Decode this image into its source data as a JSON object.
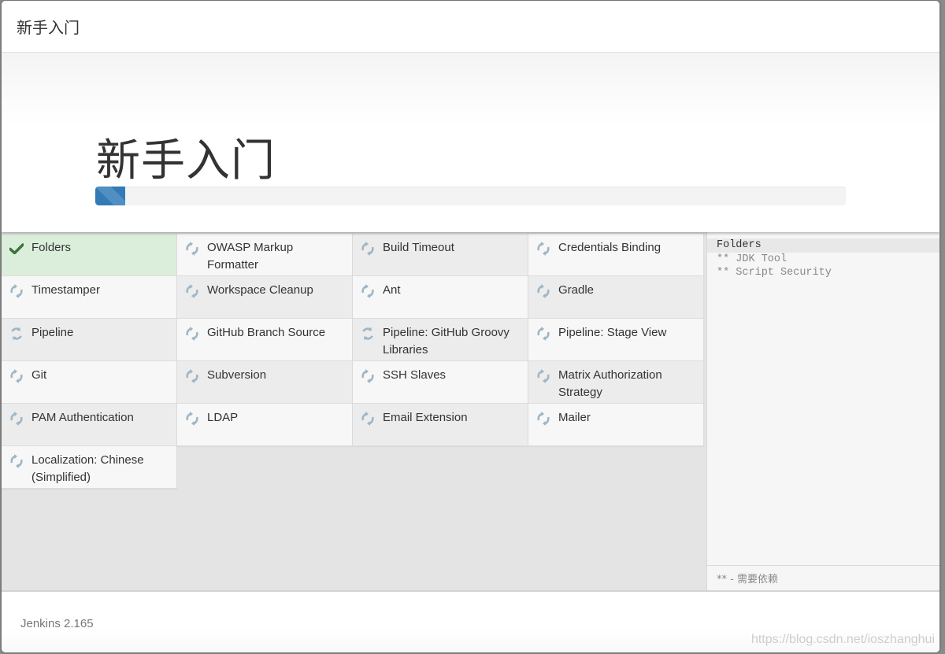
{
  "header": {
    "title": "新手入门"
  },
  "hero": {
    "title": "新手入门",
    "progress_percent": 4
  },
  "colors": {
    "accent": "#337ab7",
    "success_bg": "#dbeedb",
    "success_icon": "#3c763d",
    "pending_icon": "#9fb6c6"
  },
  "plugins": [
    {
      "name": "Folders",
      "status": "success",
      "icon": "check-icon"
    },
    {
      "name": "OWASP Markup Formatter",
      "status": "pending",
      "icon": "refresh-icon"
    },
    {
      "name": "Build Timeout",
      "status": "pending",
      "icon": "refresh-icon"
    },
    {
      "name": "Credentials Binding",
      "status": "pending",
      "icon": "refresh-icon"
    },
    {
      "name": "Timestamper",
      "status": "pending",
      "icon": "refresh-icon"
    },
    {
      "name": "Workspace Cleanup",
      "status": "pending",
      "icon": "refresh-icon"
    },
    {
      "name": "Ant",
      "status": "pending",
      "icon": "refresh-icon"
    },
    {
      "name": "Gradle",
      "status": "pending",
      "icon": "refresh-icon"
    },
    {
      "name": "Pipeline",
      "status": "installing",
      "icon": "refresh-icon"
    },
    {
      "name": "GitHub Branch Source",
      "status": "pending",
      "icon": "refresh-icon"
    },
    {
      "name": "Pipeline: GitHub Groovy Libraries",
      "status": "installing",
      "icon": "refresh-icon"
    },
    {
      "name": "Pipeline: Stage View",
      "status": "pending",
      "icon": "refresh-icon"
    },
    {
      "name": "Git",
      "status": "pending",
      "icon": "refresh-icon"
    },
    {
      "name": "Subversion",
      "status": "pending",
      "icon": "refresh-icon"
    },
    {
      "name": "SSH Slaves",
      "status": "pending",
      "icon": "refresh-icon"
    },
    {
      "name": "Matrix Authorization Strategy",
      "status": "pending",
      "icon": "refresh-icon"
    },
    {
      "name": "PAM Authentication",
      "status": "pending",
      "icon": "refresh-icon"
    },
    {
      "name": "LDAP",
      "status": "pending",
      "icon": "refresh-icon"
    },
    {
      "name": "Email Extension",
      "status": "pending",
      "icon": "refresh-icon"
    },
    {
      "name": "Mailer",
      "status": "pending",
      "icon": "refresh-icon"
    },
    {
      "name": "Localization: Chinese (Simplified)",
      "status": "pending",
      "icon": "refresh-icon"
    }
  ],
  "log": {
    "lines": [
      {
        "text": "Folders",
        "current": true
      },
      {
        "text": "** JDK Tool",
        "current": false
      },
      {
        "text": "** Script Security",
        "current": false
      }
    ],
    "legend": "** - 需要依赖"
  },
  "footer": {
    "version": "Jenkins 2.165",
    "watermark": "https://blog.csdn.net/ioszhanghui"
  }
}
